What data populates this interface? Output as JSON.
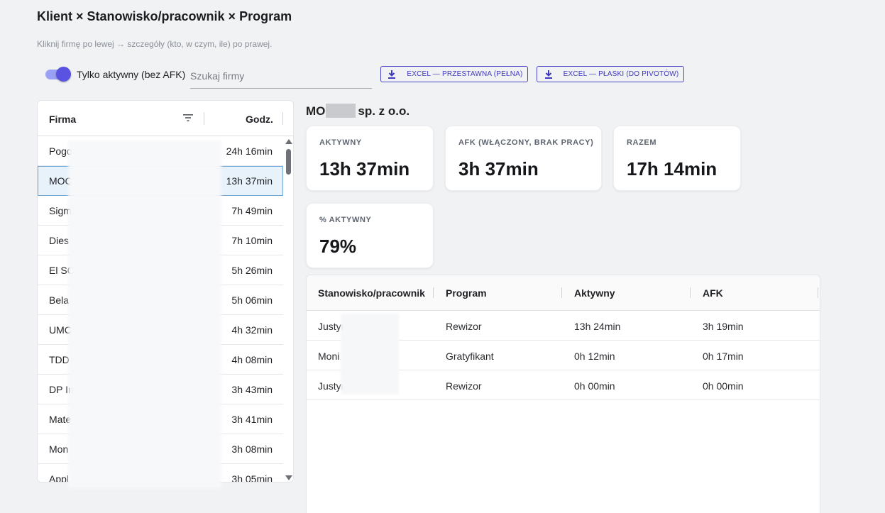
{
  "page": {
    "title": "Klient × Stanowisko/pracownik × Program",
    "subtitle": "Kliknij firmę po lewej → szczegóły (kto, w czym, ile) po prawej."
  },
  "toolbar": {
    "toggle_label": "Tylko aktywny (bez AFK)",
    "toggle_on": true,
    "search_placeholder": "Szukaj firmy",
    "export_pivot_label": "EXCEL — PRZESTAWNA (PEŁNA)",
    "export_flat_label": "EXCEL — PŁASKI (DO PIVOTÓW)"
  },
  "companies": {
    "col_firm": "Firma",
    "col_hours": "Godz.",
    "rows": [
      {
        "name": "Pogo",
        "hours": "24h 16min"
      },
      {
        "name": "MOC",
        "hours": "13h 37min"
      },
      {
        "name": "Sigm",
        "hours": "7h 49min"
      },
      {
        "name": "Dies",
        "hours": "7h 10min"
      },
      {
        "name": "El SC",
        "hours": "5h 26min"
      },
      {
        "name": "Bela",
        "hours": "5h 06min"
      },
      {
        "name": "UMC",
        "hours": "4h 32min"
      },
      {
        "name": "TDD",
        "hours": "4h 08min"
      },
      {
        "name": "DP In",
        "hours": "3h 43min"
      },
      {
        "name": "Mate",
        "hours": "3h 41min"
      },
      {
        "name": "Mon",
        "hours": "3h 08min"
      },
      {
        "name": "Appl",
        "hours": "3h 05min"
      }
    ]
  },
  "detail": {
    "company_prefix": "MO",
    "company_suffix": "sp. z o.o.",
    "stats": {
      "active_label": "AKTYWNY",
      "active_value": "13h 37min",
      "afk_label": "AFK (WŁĄCZONY, BRAK PRACY)",
      "afk_value": "3h 37min",
      "total_label": "RAZEM",
      "total_value": "17h 14min",
      "pct_label": "% AKTYWNY",
      "pct_value": "79%"
    },
    "table": {
      "col_worker": "Stanowisko/pracownik",
      "col_program": "Program",
      "col_active": "Aktywny",
      "col_afk": "AFK",
      "rows": [
        {
          "worker": "Justyn",
          "program": "Rewizor",
          "active": "13h 24min",
          "afk": "3h 19min"
        },
        {
          "worker": "Moni",
          "program": "Gratyfikant",
          "active": "0h 12min",
          "afk": "0h 17min"
        },
        {
          "worker": "Justyn",
          "program": "Rewizor",
          "active": "0h 00min",
          "afk": "0h 00min"
        }
      ]
    }
  },
  "colors": {
    "accent": "#4b45c6",
    "toggle_thumb": "#5a52e0",
    "selected_row": "#e7f2fb"
  }
}
